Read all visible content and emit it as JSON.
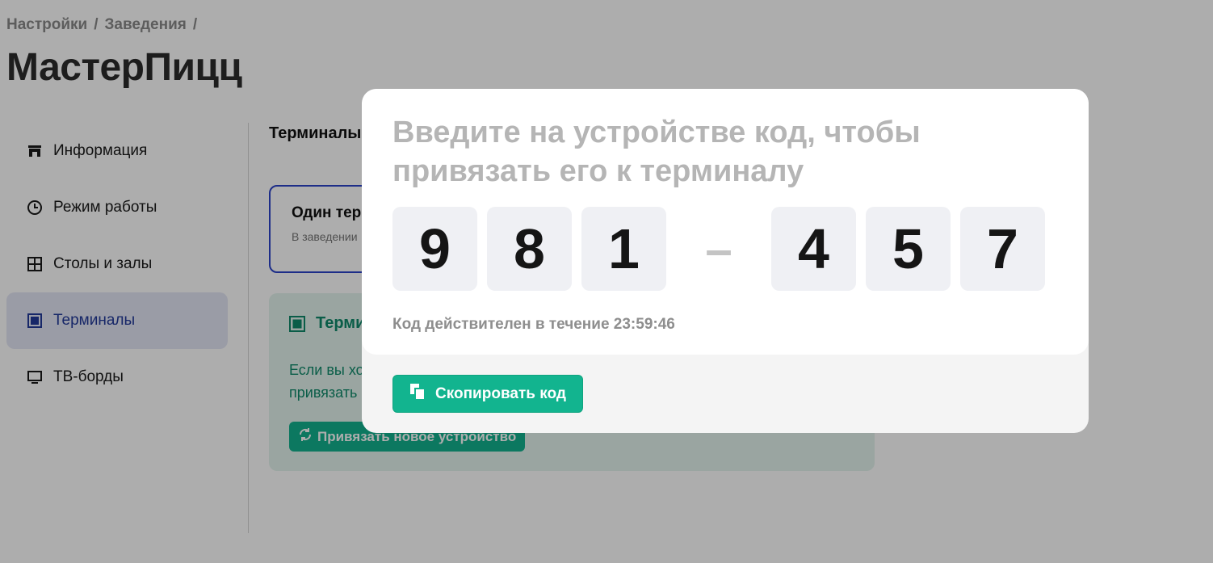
{
  "breadcrumb": {
    "items": [
      "Настройки",
      "Заведения"
    ],
    "separator": "/"
  },
  "page": {
    "title": "МастерПицц"
  },
  "sidebar": {
    "items": [
      {
        "label": "Информация",
        "icon": "store-icon",
        "active": false
      },
      {
        "label": "Режим работы",
        "icon": "clock-icon",
        "active": false
      },
      {
        "label": "Столы и залы",
        "icon": "grid-icon",
        "active": false
      },
      {
        "label": "Терминалы",
        "icon": "terminal-icon",
        "active": true
      },
      {
        "label": "ТВ-борды",
        "icon": "monitor-icon",
        "active": false
      }
    ]
  },
  "main": {
    "section_title": "Терминалы",
    "option_card": {
      "title": "Один тер",
      "subtitle": "В заведении"
    },
    "info_card": {
      "title": "Терми",
      "text_line1": "Если вы хо",
      "text_line2": "привязать",
      "button_label": "Привязать новое устройство"
    }
  },
  "modal": {
    "title": "Введите на устройстве код, чтобы привязать его к терминалу",
    "code_left": [
      "9",
      "8",
      "1"
    ],
    "code_right": [
      "4",
      "5",
      "7"
    ],
    "code_separator": "–",
    "validity_text": "Код действителен в течение 23:59:46",
    "copy_button_label": "Скопировать код"
  },
  "colors": {
    "accent": "#12b48f",
    "active_nav": "#233a9a",
    "option_border": "#2b43c9"
  }
}
